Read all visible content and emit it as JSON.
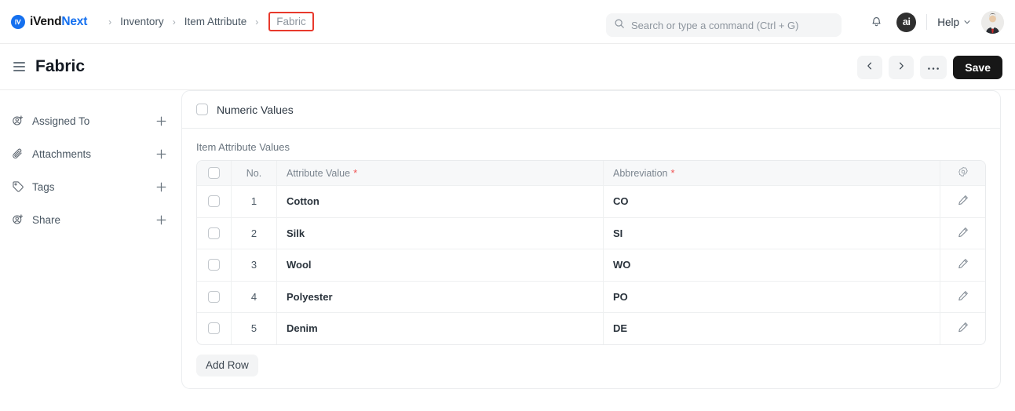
{
  "brand": {
    "part1": "iVend",
    "part2": "Next",
    "mark_icon": "ivend-logo-icon"
  },
  "breadcrumbs": [
    {
      "label": "Inventory",
      "highlighted": false
    },
    {
      "label": "Item Attribute",
      "highlighted": false
    },
    {
      "label": "Fabric",
      "highlighted": true
    }
  ],
  "breadcrumb_separator": "›",
  "search": {
    "placeholder": "Search or type a command (Ctrl + G)",
    "value": "",
    "icon": "search-icon"
  },
  "nav_right": {
    "notifications_icon": "bell-icon",
    "ai_badge_label": "ai",
    "help_label": "Help",
    "help_chevron_icon": "chevron-down-icon",
    "avatar_icon": "user-avatar"
  },
  "titlebar": {
    "menu_icon": "hamburger-menu-icon",
    "title": "Fabric",
    "prev_icon": "chevron-left-icon",
    "next_icon": "chevron-right-icon",
    "more_icon": "ellipsis-icon",
    "save_label": "Save"
  },
  "sidebar": {
    "items": [
      {
        "label": "Assigned To",
        "icon": "user-plus-icon",
        "add_icon": "plus-icon"
      },
      {
        "label": "Attachments",
        "icon": "paperclip-icon",
        "add_icon": "plus-icon"
      },
      {
        "label": "Tags",
        "icon": "tag-icon",
        "add_icon": "plus-icon"
      },
      {
        "label": "Share",
        "icon": "share-user-icon",
        "add_icon": "plus-icon"
      }
    ]
  },
  "panel": {
    "numeric_values_label": "Numeric Values",
    "numeric_values_checked": false,
    "section_label": "Item Attribute Values",
    "table": {
      "columns": [
        {
          "key": "select",
          "label": ""
        },
        {
          "key": "no",
          "label": "No."
        },
        {
          "key": "attribute_value",
          "label": "Attribute Value",
          "required": true
        },
        {
          "key": "abbreviation",
          "label": "Abbreviation",
          "required": true
        },
        {
          "key": "actions",
          "label": "",
          "icon": "settings-gear-icon"
        }
      ],
      "required_marker": "*",
      "rows": [
        {
          "no": "1",
          "attribute_value": "Cotton",
          "abbreviation": "CO",
          "edit_icon": "pencil-edit-icon"
        },
        {
          "no": "2",
          "attribute_value": "Silk",
          "abbreviation": "SI",
          "edit_icon": "pencil-edit-icon"
        },
        {
          "no": "3",
          "attribute_value": "Wool",
          "abbreviation": "WO",
          "edit_icon": "pencil-edit-icon"
        },
        {
          "no": "4",
          "attribute_value": "Polyester",
          "abbreviation": "PO",
          "edit_icon": "pencil-edit-icon"
        },
        {
          "no": "5",
          "attribute_value": "Denim",
          "abbreviation": "DE",
          "edit_icon": "pencil-edit-icon"
        }
      ]
    },
    "add_row_label": "Add Row"
  },
  "colors": {
    "brand_blue": "#1570ef",
    "highlight_red": "#e8392c",
    "required_red": "#f05252",
    "save_black": "#171717"
  }
}
